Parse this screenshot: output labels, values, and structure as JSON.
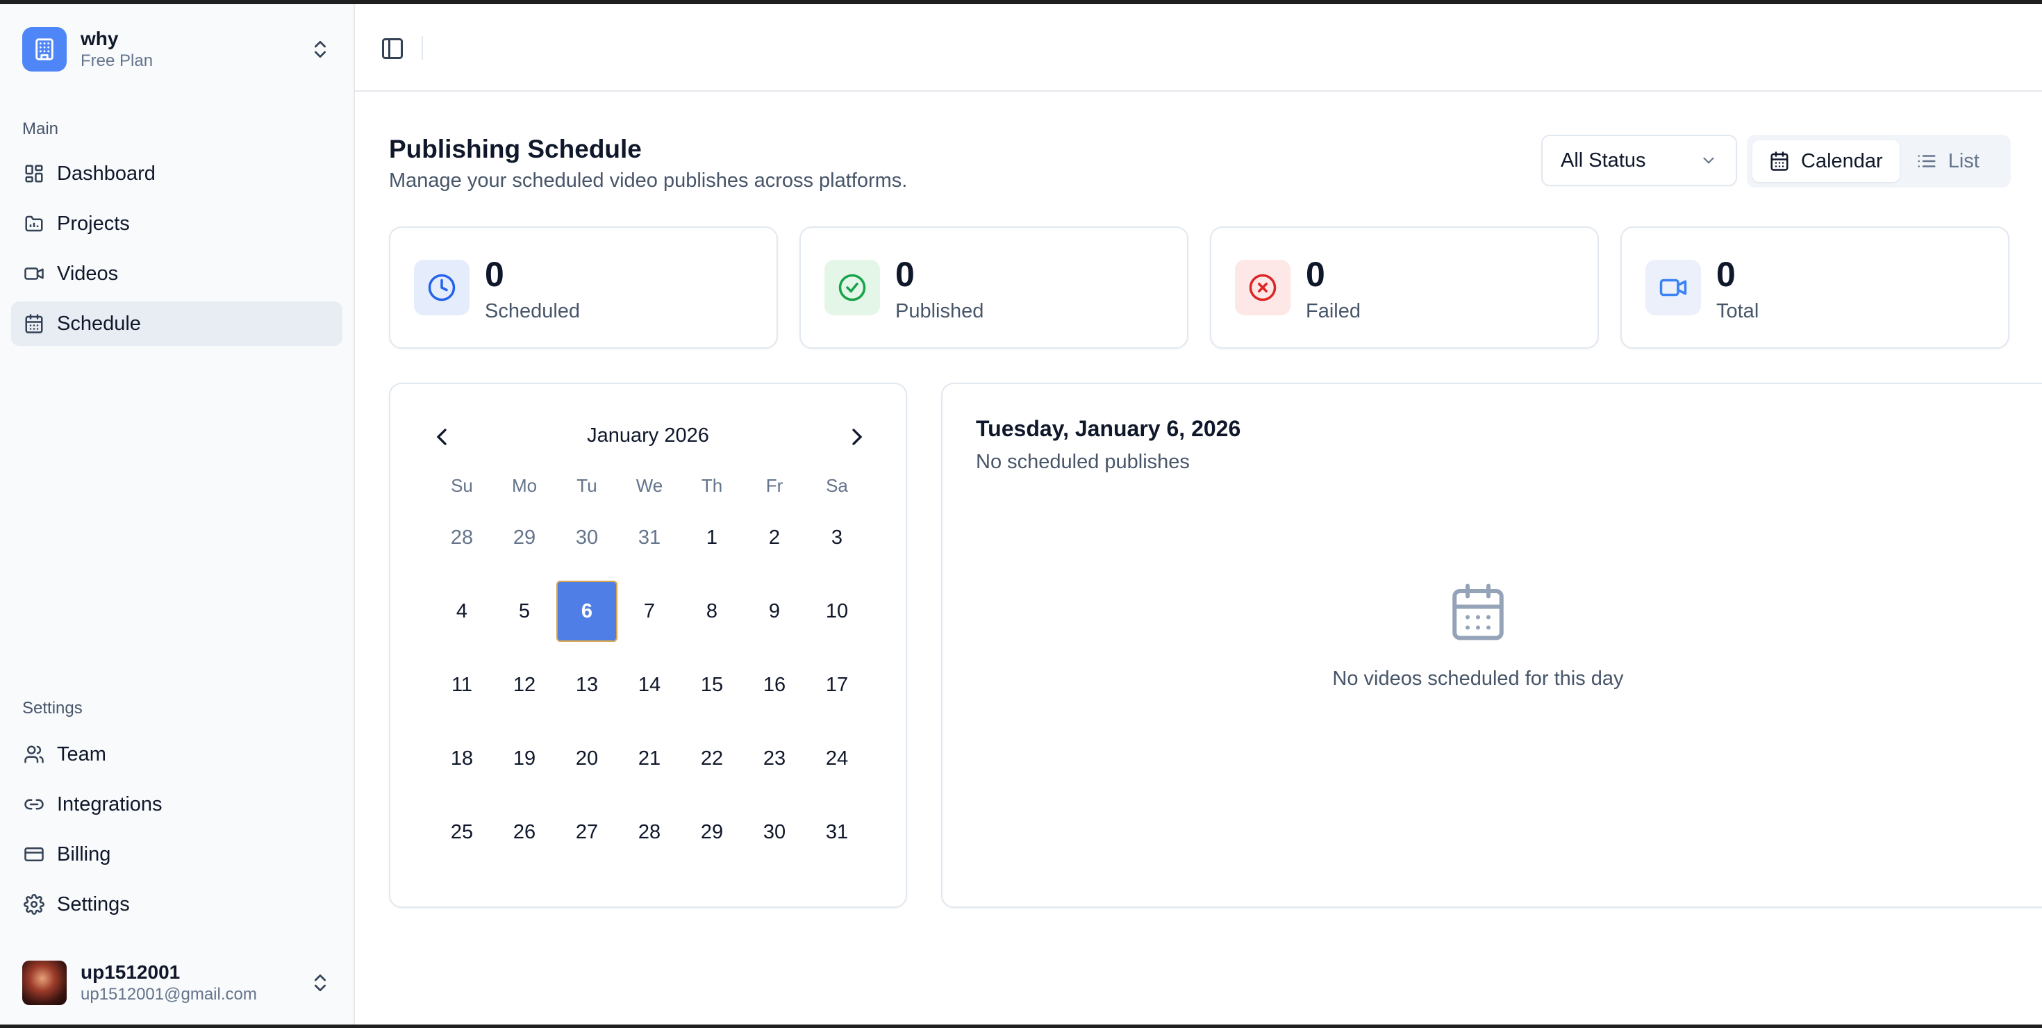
{
  "workspace": {
    "name": "why",
    "plan": "Free Plan"
  },
  "sidebar": {
    "main_label": "Main",
    "main_items": [
      {
        "label": "Dashboard",
        "icon": "dashboard-icon"
      },
      {
        "label": "Projects",
        "icon": "projects-icon"
      },
      {
        "label": "Videos",
        "icon": "video-icon"
      },
      {
        "label": "Schedule",
        "icon": "calendar-icon",
        "active": true
      }
    ],
    "settings_label": "Settings",
    "settings_items": [
      {
        "label": "Team",
        "icon": "users-icon"
      },
      {
        "label": "Integrations",
        "icon": "link-icon"
      },
      {
        "label": "Billing",
        "icon": "credit-card-icon"
      },
      {
        "label": "Settings",
        "icon": "gear-icon"
      }
    ]
  },
  "user": {
    "name": "up1512001",
    "email": "up1512001@gmail.com"
  },
  "header": {
    "title": "Publishing Schedule",
    "subtitle": "Manage your scheduled video publishes across platforms."
  },
  "filters": {
    "status": "All Status",
    "views": [
      {
        "label": "Calendar",
        "active": true
      },
      {
        "label": "List",
        "active": false
      }
    ]
  },
  "stats": [
    {
      "value": "0",
      "label": "Scheduled",
      "icon": "clock-icon",
      "color": "#2563eb",
      "bg": "#e5edfc"
    },
    {
      "value": "0",
      "label": "Published",
      "icon": "check-circle-icon",
      "color": "#16a34a",
      "bg": "#e4f6e8"
    },
    {
      "value": "0",
      "label": "Failed",
      "icon": "x-circle-icon",
      "color": "#dc2626",
      "bg": "#fde7e7"
    },
    {
      "value": "0",
      "label": "Total",
      "icon": "video-icon",
      "color": "#3b82f6",
      "bg": "#ebf0fb"
    }
  ],
  "calendar": {
    "month": "January 2026",
    "weekdays": [
      "Su",
      "Mo",
      "Tu",
      "We",
      "Th",
      "Fr",
      "Sa"
    ],
    "weeks": [
      [
        "28",
        "29",
        "30",
        "31",
        "1",
        "2",
        "3"
      ],
      [
        "4",
        "5",
        "6",
        "7",
        "8",
        "9",
        "10"
      ],
      [
        "11",
        "12",
        "13",
        "14",
        "15",
        "16",
        "17"
      ],
      [
        "18",
        "19",
        "20",
        "21",
        "22",
        "23",
        "24"
      ],
      [
        "25",
        "26",
        "27",
        "28",
        "29",
        "30",
        "31"
      ]
    ],
    "outside_days_first_week": 4,
    "selected": "6"
  },
  "day_panel": {
    "title": "Tuesday, January 6, 2026",
    "subtitle": "No scheduled publishes",
    "empty_text": "No videos scheduled for this day"
  }
}
